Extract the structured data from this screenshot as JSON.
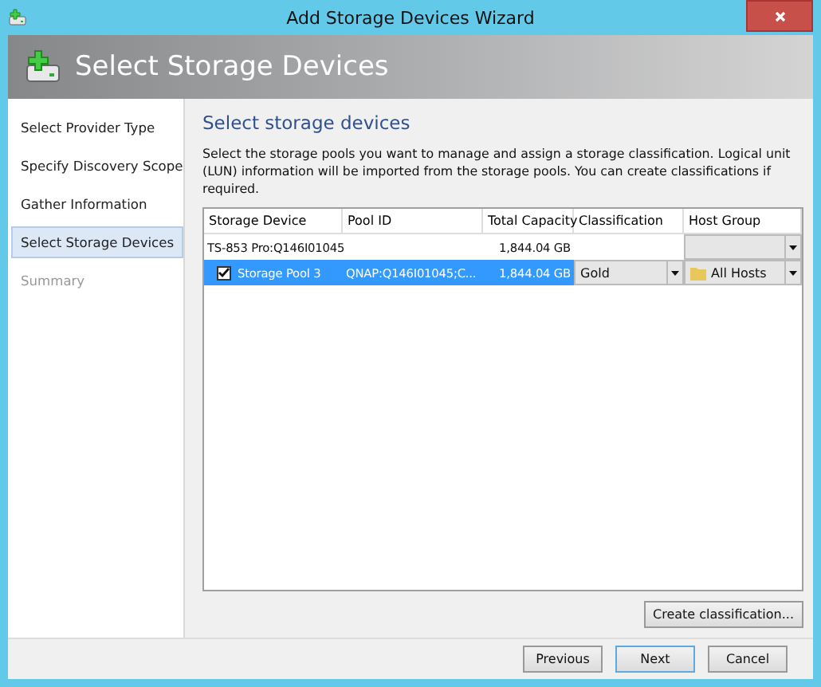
{
  "window": {
    "title": "Add Storage Devices Wizard"
  },
  "header": {
    "title": "Select Storage Devices"
  },
  "steps": [
    {
      "label": "Select Provider Type",
      "selected": false,
      "disabled": false
    },
    {
      "label": "Specify Discovery Scope",
      "selected": false,
      "disabled": false
    },
    {
      "label": "Gather Information",
      "selected": false,
      "disabled": false
    },
    {
      "label": "Select Storage Devices",
      "selected": true,
      "disabled": false
    },
    {
      "label": "Summary",
      "selected": false,
      "disabled": true
    }
  ],
  "page": {
    "heading": "Select storage devices",
    "description": "Select the storage pools you want to manage and assign a storage classification. Logical unit  (LUN) information will be imported from the storage pools.  You can create classifications if required."
  },
  "table": {
    "columns": [
      "Storage Device",
      "Pool ID",
      "Total Capacity",
      "Classification",
      "Host Group"
    ],
    "rows": [
      {
        "kind": "device",
        "selected": false,
        "device": "TS-853 Pro:Q146I01045",
        "capacity": "1,844.04 GB"
      },
      {
        "kind": "pool",
        "selected": true,
        "checked": true,
        "device": "Storage Pool 3",
        "pool_id": "QNAP:Q146I01045;C...",
        "capacity": "1,844.04 GB",
        "classification": "Gold",
        "host_group": "All Hosts"
      }
    ]
  },
  "create_button": "Create classification...",
  "buttons": [
    "Previous",
    "Next",
    "Cancel"
  ]
}
